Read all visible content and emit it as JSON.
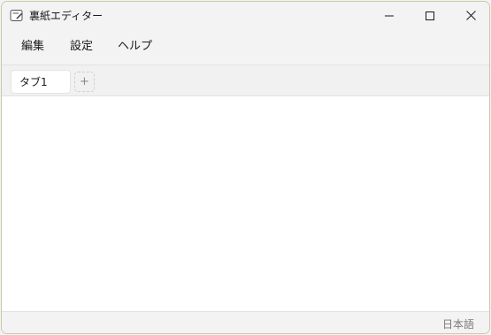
{
  "window": {
    "title": "裏紙エディター",
    "app_icon": "notepad-icon",
    "controls": {
      "minimize_icon": "minimize-icon",
      "maximize_icon": "maximize-icon",
      "close_icon": "close-icon"
    }
  },
  "menu": {
    "items": [
      {
        "label": "編集"
      },
      {
        "label": "設定"
      },
      {
        "label": "ヘルプ"
      }
    ]
  },
  "tabs": {
    "items": [
      {
        "label": "タブ1",
        "active": true
      }
    ],
    "add_label": "+"
  },
  "editor": {
    "content": ""
  },
  "status": {
    "language": "日本語"
  },
  "colors": {
    "background": "#f3f3f3",
    "editor_background": "#ffffff",
    "window_border": "#c9c9a9",
    "text": "#1a1a1a",
    "muted_text": "#7a7a7a"
  }
}
